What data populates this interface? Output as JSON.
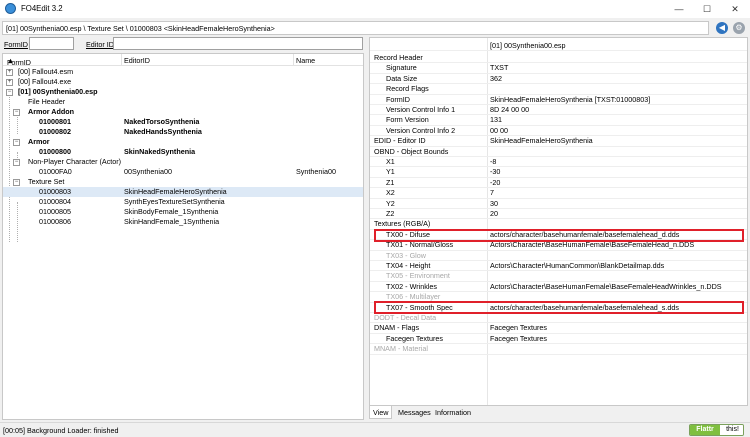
{
  "window": {
    "title": "FO4Edit 3.2",
    "minimize": "—",
    "maximize": "☐",
    "close": "✕"
  },
  "path": "[01] 00Synthenia00.esp \\ Texture Set \\ 01000803 <SkinHeadFemaleHeroSynthenia>",
  "filter": {
    "formid_label": "FormID",
    "editorid_label": "Editor ID",
    "formid_value": "",
    "editorid_value": ""
  },
  "tree": {
    "columns": [
      "FormID",
      "EditorID",
      "Name"
    ],
    "rows": [
      {
        "formid": "[00] Fallout4.esm",
        "toggle": "+"
      },
      {
        "formid": "[00] Fallout4.exe",
        "toggle": "+"
      },
      {
        "formid": "[01] 00Synthenia00.esp",
        "toggle": "−"
      },
      {
        "formid": "File Header"
      },
      {
        "formid": "Armor Addon",
        "toggle": "−"
      },
      {
        "formid": "01000801",
        "editorid": "NakedTorsoSynthenia"
      },
      {
        "formid": "01000802",
        "editorid": "NakedHandsSynthenia"
      },
      {
        "formid": "Armor",
        "toggle": "−"
      },
      {
        "formid": "01000800",
        "editorid": "SkinNakedSynthenia"
      },
      {
        "formid": "Non-Player Character (Actor)",
        "toggle": "−"
      },
      {
        "formid": "01000FA0",
        "editorid": "00Synthenia00",
        "name": "Synthenia00"
      },
      {
        "formid": "Texture Set",
        "toggle": "−"
      },
      {
        "formid": "01000803",
        "editorid": "SkinHeadFemaleHeroSynthenia"
      },
      {
        "formid": "01000804",
        "editorid": "SynthEyesTextureSetSynthenia"
      },
      {
        "formid": "01000805",
        "editorid": "SkinBodyFemale_1Synthenia"
      },
      {
        "formid": "01000806",
        "editorid": "SkinHandFemale_1Synthenia"
      }
    ]
  },
  "record": {
    "header_value": "[01] 00Synthenia00.esp",
    "rows": [
      {
        "label": "Record Header",
        "value": ""
      },
      {
        "label": "Signature",
        "value": "TXST"
      },
      {
        "label": "Data Size",
        "value": "362"
      },
      {
        "label": "Record Flags",
        "value": ""
      },
      {
        "label": "FormID",
        "value": "SkinHeadFemaleHeroSynthenia [TXST:01000803]"
      },
      {
        "label": "Version Control Info 1",
        "value": "8D 24 00 00"
      },
      {
        "label": "Form Version",
        "value": "131"
      },
      {
        "label": "Version Control Info 2",
        "value": "00 00"
      },
      {
        "label": "EDID - Editor ID",
        "value": "SkinHeadFemaleHeroSynthenia"
      },
      {
        "label": "OBND - Object Bounds",
        "value": ""
      },
      {
        "label": "X1",
        "value": "-8"
      },
      {
        "label": "Y1",
        "value": "-30"
      },
      {
        "label": "Z1",
        "value": "-20"
      },
      {
        "label": "X2",
        "value": "7"
      },
      {
        "label": "Y2",
        "value": "30"
      },
      {
        "label": "Z2",
        "value": "20"
      },
      {
        "label": "Textures (RGB/A)",
        "value": ""
      },
      {
        "label": "TX00 - Difuse",
        "value": "actors/character/basehumanfemale/basefemalehead_d.dds"
      },
      {
        "label": "TX01 - Normal/Gloss",
        "value": "Actors\\Character\\BaseHumanFemale\\BaseFemaleHead_n.DDS"
      },
      {
        "label": "TX03 - Glow",
        "value": ""
      },
      {
        "label": "TX04 - Height",
        "value": "Actors\\Character\\HumanCommon\\BlankDetailmap.dds"
      },
      {
        "label": "TX05 - Environment",
        "value": ""
      },
      {
        "label": "TX02 - Wrinkles",
        "value": "Actors\\Character\\BaseHumanFemale\\BaseFemaleHeadWrinkles_n.DDS"
      },
      {
        "label": "TX06 - Multilayer",
        "value": ""
      },
      {
        "label": "TX07 - Smooth Spec",
        "value": "actors/character/basehumanfemale/basefemalehead_s.dds"
      },
      {
        "label": "DODT - Decal Data",
        "value": ""
      },
      {
        "label": "DNAM - Flags",
        "value": "Facegen Textures"
      },
      {
        "label": "Facegen Textures",
        "value": "Facegen Textures"
      },
      {
        "label": "MNAM - Material",
        "value": ""
      }
    ]
  },
  "tabs": [
    "View",
    "Messages",
    "Information"
  ],
  "status": {
    "text": "[00:05] Background Loader: finished",
    "flattr_left": "Flattr",
    "flattr_right": "this!"
  },
  "colors": {
    "highlight": "#e0202a",
    "selection": "#dde9f6",
    "flattr_green": "#7fbf3f"
  }
}
